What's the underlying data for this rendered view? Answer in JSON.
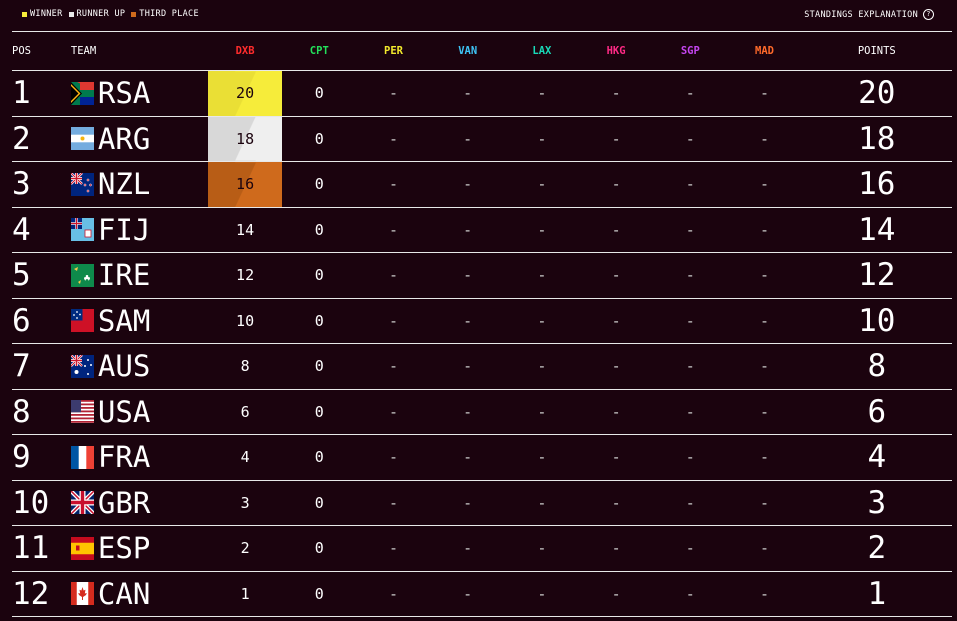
{
  "legend": [
    {
      "label": "WINNER",
      "color": "#f6ec3a"
    },
    {
      "label": "RUNNER UP",
      "color": "#e8e8e8"
    },
    {
      "label": "THIRD PLACE",
      "color": "#cf6a1c"
    }
  ],
  "explanation_label": "STANDINGS EXPLANATION",
  "headers": {
    "pos": "POS",
    "team": "TEAM",
    "points": "POINTS"
  },
  "events": [
    {
      "code": "DXB",
      "color": "#ff2c2c"
    },
    {
      "code": "CPT",
      "color": "#23e05a"
    },
    {
      "code": "PER",
      "color": "#f2ea2c"
    },
    {
      "code": "VAN",
      "color": "#3ec4f5"
    },
    {
      "code": "LAX",
      "color": "#19d9b8"
    },
    {
      "code": "HKG",
      "color": "#ff2a85"
    },
    {
      "code": "SGP",
      "color": "#c646f0"
    },
    {
      "code": "MAD",
      "color": "#ff6a2a"
    }
  ],
  "rows": [
    {
      "pos": "1",
      "team": "RSA",
      "flag": "flag-rsa-icon",
      "scores": [
        "20",
        "0",
        "-",
        "-",
        "-",
        "-",
        "-",
        "-"
      ],
      "points": "20",
      "highlight": 1
    },
    {
      "pos": "2",
      "team": "ARG",
      "flag": "flag-arg-icon",
      "scores": [
        "18",
        "0",
        "-",
        "-",
        "-",
        "-",
        "-",
        "-"
      ],
      "points": "18",
      "highlight": 2
    },
    {
      "pos": "3",
      "team": "NZL",
      "flag": "flag-nzl-icon",
      "scores": [
        "16",
        "0",
        "-",
        "-",
        "-",
        "-",
        "-",
        "-"
      ],
      "points": "16",
      "highlight": 3
    },
    {
      "pos": "4",
      "team": "FIJ",
      "flag": "flag-fij-icon",
      "scores": [
        "14",
        "0",
        "-",
        "-",
        "-",
        "-",
        "-",
        "-"
      ],
      "points": "14",
      "highlight": 0
    },
    {
      "pos": "5",
      "team": "IRE",
      "flag": "flag-ire-icon",
      "scores": [
        "12",
        "0",
        "-",
        "-",
        "-",
        "-",
        "-",
        "-"
      ],
      "points": "12",
      "highlight": 0
    },
    {
      "pos": "6",
      "team": "SAM",
      "flag": "flag-sam-icon",
      "scores": [
        "10",
        "0",
        "-",
        "-",
        "-",
        "-",
        "-",
        "-"
      ],
      "points": "10",
      "highlight": 0
    },
    {
      "pos": "7",
      "team": "AUS",
      "flag": "flag-aus-icon",
      "scores": [
        "8",
        "0",
        "-",
        "-",
        "-",
        "-",
        "-",
        "-"
      ],
      "points": "8",
      "highlight": 0
    },
    {
      "pos": "8",
      "team": "USA",
      "flag": "flag-usa-icon",
      "scores": [
        "6",
        "0",
        "-",
        "-",
        "-",
        "-",
        "-",
        "-"
      ],
      "points": "6",
      "highlight": 0
    },
    {
      "pos": "9",
      "team": "FRA",
      "flag": "flag-fra-icon",
      "scores": [
        "4",
        "0",
        "-",
        "-",
        "-",
        "-",
        "-",
        "-"
      ],
      "points": "4",
      "highlight": 0
    },
    {
      "pos": "10",
      "team": "GBR",
      "flag": "flag-gbr-icon",
      "scores": [
        "3",
        "0",
        "-",
        "-",
        "-",
        "-",
        "-",
        "-"
      ],
      "points": "3",
      "highlight": 0
    },
    {
      "pos": "11",
      "team": "ESP",
      "flag": "flag-esp-icon",
      "scores": [
        "2",
        "0",
        "-",
        "-",
        "-",
        "-",
        "-",
        "-"
      ],
      "points": "2",
      "highlight": 0
    },
    {
      "pos": "12",
      "team": "CAN",
      "flag": "flag-can-icon",
      "scores": [
        "1",
        "0",
        "-",
        "-",
        "-",
        "-",
        "-",
        "-"
      ],
      "points": "1",
      "highlight": 0
    }
  ]
}
